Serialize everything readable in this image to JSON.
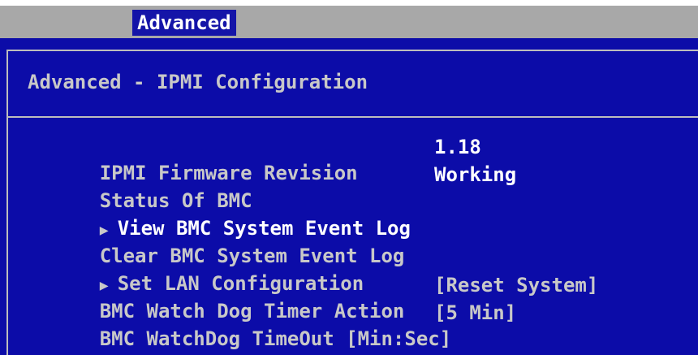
{
  "menubar": {
    "active_tab": "Advanced"
  },
  "panel": {
    "title": "Advanced - IPMI Configuration",
    "items": [
      {
        "label": "IPMI Firmware Revision",
        "value": "1.18",
        "submenu": false
      },
      {
        "label": "Status Of BMC",
        "value": "Working",
        "submenu": false
      },
      {
        "label": "View BMC System Event Log",
        "value": "",
        "submenu": true,
        "selected": true
      },
      {
        "label": "Clear BMC System Event Log",
        "value": "",
        "submenu": false
      },
      {
        "label": "Set LAN Configuration",
        "value": "",
        "submenu": true
      },
      {
        "label": "BMC Watch Dog Timer Action",
        "value": "[Reset System]",
        "submenu": false
      },
      {
        "label": "BMC WatchDog TimeOut [Min:Sec]",
        "value": "[5 Min]",
        "submenu": false
      }
    ]
  },
  "icons": {
    "submenu_arrow": "▶"
  },
  "colors": {
    "panel_background": "#0c0ca8",
    "menubar_background": "#a8a8a8",
    "text": "#c8c8c8",
    "highlight_text": "#ffffff"
  }
}
